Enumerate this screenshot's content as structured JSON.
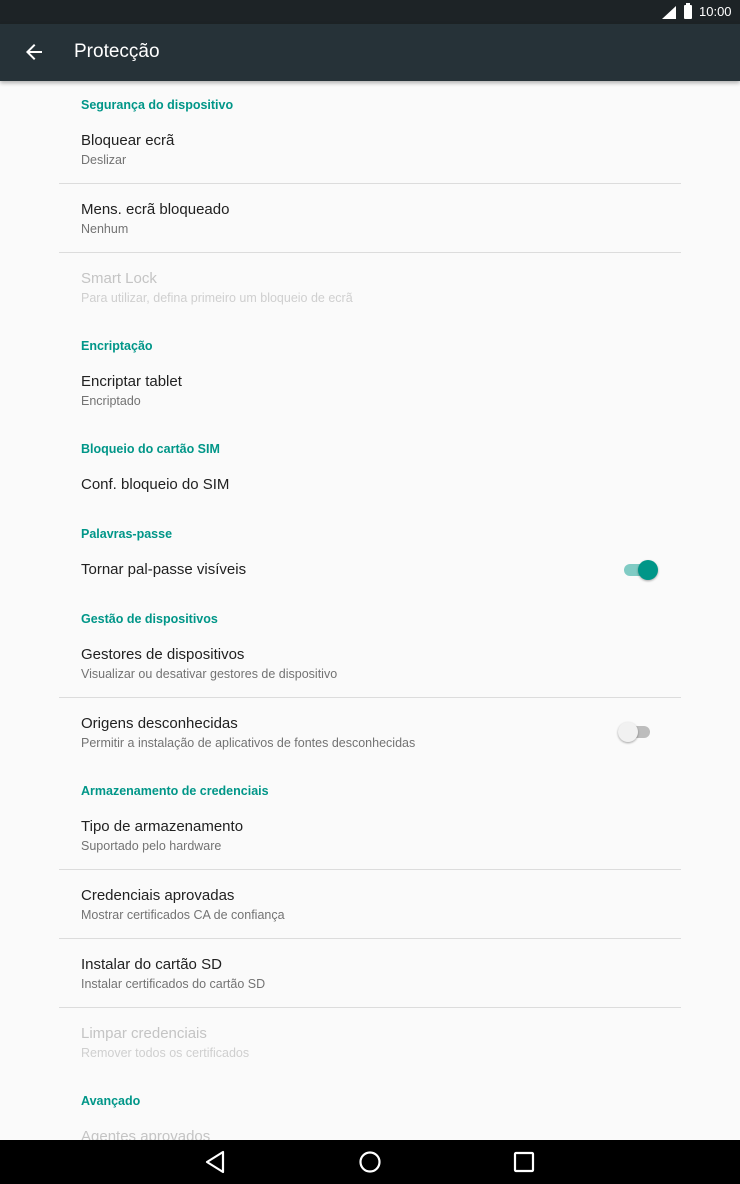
{
  "status_bar": {
    "time": "10:00",
    "signal_icon": "signal-icon",
    "battery_icon": "battery-icon"
  },
  "app_bar": {
    "title": "Protecção",
    "back_icon": "arrow-back-icon"
  },
  "sections": {
    "device_security": {
      "header": "Segurança do dispositivo",
      "lock_screen": {
        "title": "Bloquear ecrã",
        "summary": "Deslizar"
      },
      "lock_message": {
        "title": "Mens. ecrã bloqueado",
        "summary": "Nenhum"
      },
      "smart_lock": {
        "title": "Smart Lock",
        "summary": "Para utilizar, defina primeiro um bloqueio de ecrã"
      }
    },
    "encryption": {
      "header": "Encriptação",
      "encrypt_tablet": {
        "title": "Encriptar tablet",
        "summary": "Encriptado"
      }
    },
    "sim_lock": {
      "header": "Bloqueio do cartão SIM",
      "sim_setup": {
        "title": "Conf. bloqueio do SIM"
      }
    },
    "passwords": {
      "header": "Palavras-passe",
      "visible_passwords": {
        "title": "Tornar pal-passe visíveis",
        "enabled": true
      }
    },
    "device_admin": {
      "header": "Gestão de dispositivos",
      "admins": {
        "title": "Gestores de dispositivos",
        "summary": "Visualizar ou desativar gestores de dispositivo"
      },
      "unknown_sources": {
        "title": "Origens desconhecidas",
        "summary": "Permitir a instalação de aplicativos de fontes desconhecidas",
        "enabled": false
      }
    },
    "credentials": {
      "header": "Armazenamento de credenciais",
      "storage_type": {
        "title": "Tipo de armazenamento",
        "summary": "Suportado pelo hardware"
      },
      "trusted": {
        "title": "Credenciais aprovadas",
        "summary": "Mostrar certificados CA de confiança"
      },
      "install_sd": {
        "title": "Instalar do cartão SD",
        "summary": "Instalar certificados do cartão SD"
      },
      "clear": {
        "title": "Limpar credenciais",
        "summary": "Remover todos os certificados"
      }
    },
    "advanced": {
      "header": "Avançado",
      "trust_agents": {
        "title": "Agentes aprovados"
      }
    }
  },
  "colors": {
    "accent": "#009688",
    "app_bar": "#263238",
    "status_bar": "#1d2326"
  },
  "nav_bar": {
    "back_icon": "nav-back-icon",
    "home_icon": "nav-home-icon",
    "recents_icon": "nav-recents-icon"
  }
}
